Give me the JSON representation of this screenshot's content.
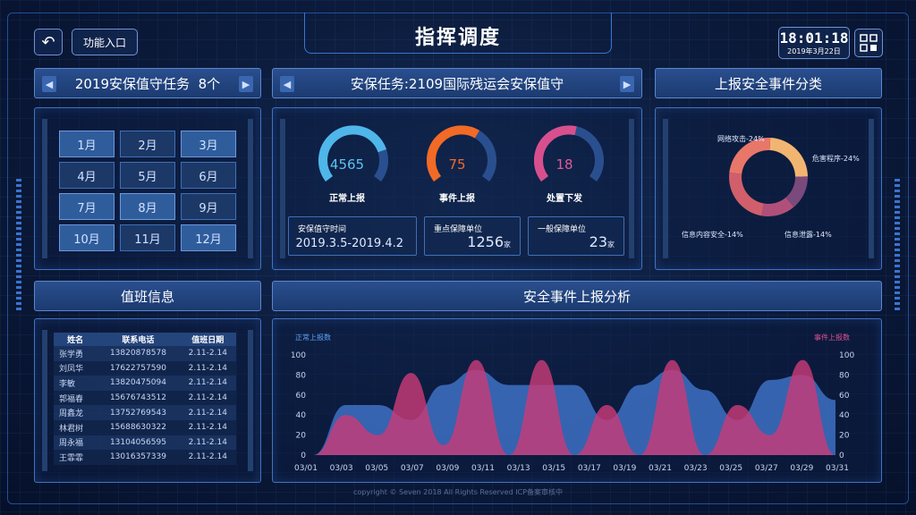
{
  "header": {
    "back_icon": "back-arrow-icon",
    "function_entry": "功能入口",
    "title": "指挥调度",
    "time": "18:01:18",
    "date": "2019年3月22日",
    "grid_icon": "grid-menu-icon"
  },
  "tasks_panel": {
    "title": "2019安保值守任务  8个",
    "months": [
      "1月",
      "2月",
      "3月",
      "4月",
      "5月",
      "6月",
      "7月",
      "8月",
      "9月",
      "10月",
      "11月",
      "12月"
    ],
    "active_months": [
      "1月",
      "3月",
      "7月",
      "8月",
      "10月",
      "12月"
    ]
  },
  "security_panel": {
    "title": "安保任务:2109国际残运会安保值守",
    "gauges": [
      {
        "value": "4565",
        "label": "正常上报",
        "color": "#4fb6ea"
      },
      {
        "value": "75",
        "label": "事件上报",
        "color": "#f26a25"
      },
      {
        "value": "18",
        "label": "处置下发",
        "color": "#d84f8e"
      }
    ],
    "boxes": [
      {
        "label": "安保值守时间",
        "value": "2019.3.5-2019.4.2",
        "unit": ""
      },
      {
        "label": "重点保障单位",
        "value": "1256",
        "unit": "家"
      },
      {
        "label": "一般保障单位",
        "value": "23",
        "unit": "家"
      }
    ]
  },
  "events_panel": {
    "title": "上报安全事件分类",
    "slices": [
      {
        "label": "网络攻击-24%",
        "value": 24,
        "color": "#e8776a"
      },
      {
        "label": "危害程序-24%",
        "value": 24,
        "color": "#f2b571"
      },
      {
        "label": "信息泄露-14%",
        "value": 14,
        "color": "#7a4a7c"
      },
      {
        "label": "信息内容安全-14%",
        "value": 14,
        "color": "#b0507a"
      },
      {
        "label": "",
        "value": 24,
        "color": "#d05f6b"
      }
    ]
  },
  "duty_panel": {
    "title": "值班信息",
    "columns": [
      "姓名",
      "联系电话",
      "值班日期"
    ],
    "rows": [
      [
        "张学勇",
        "13820878578",
        "2.11-2.14"
      ],
      [
        "刘凤华",
        "17622757590",
        "2.11-2.14"
      ],
      [
        "李敏",
        "13820475094",
        "2.11-2.14"
      ],
      [
        "郭福春",
        "15676743512",
        "2.11-2.14"
      ],
      [
        "周鑫龙",
        "13752769543",
        "2.11-2.14"
      ],
      [
        "林君树",
        "15688630322",
        "2.11-2.14"
      ],
      [
        "周永福",
        "13104056595",
        "2.11-2.14"
      ],
      [
        "王霏霏",
        "13016357339",
        "2.11-2.14"
      ]
    ]
  },
  "analysis_panel": {
    "title": "安全事件上报分析"
  },
  "chart_data": {
    "type": "area",
    "title": "",
    "series": [
      {
        "name": "正常上报数",
        "color": "#3f74c9",
        "values": [
          0,
          50,
          50,
          35,
          70,
          85,
          70,
          70,
          70,
          35,
          70,
          85,
          65,
          35,
          75,
          80,
          55
        ]
      },
      {
        "name": "事件上报数",
        "color": "#c83a78",
        "values": [
          0,
          40,
          20,
          82,
          10,
          95,
          0,
          95,
          0,
          50,
          0,
          95,
          0,
          50,
          20,
          95,
          0
        ]
      }
    ],
    "x": [
      "03/01",
      "03/03",
      "03/05",
      "03/07",
      "03/09",
      "03/11",
      "03/13",
      "03/15",
      "03/17",
      "03/19",
      "03/21",
      "03/23",
      "03/25",
      "03/27",
      "03/29",
      "03/31"
    ],
    "yticks": [
      0,
      20,
      40,
      60,
      80,
      100
    ],
    "ylim": [
      0,
      100
    ],
    "grid": false
  },
  "footer": {
    "copyright": "copyright © Seven 2018 All Rights Reserved ICP备案审核中"
  }
}
